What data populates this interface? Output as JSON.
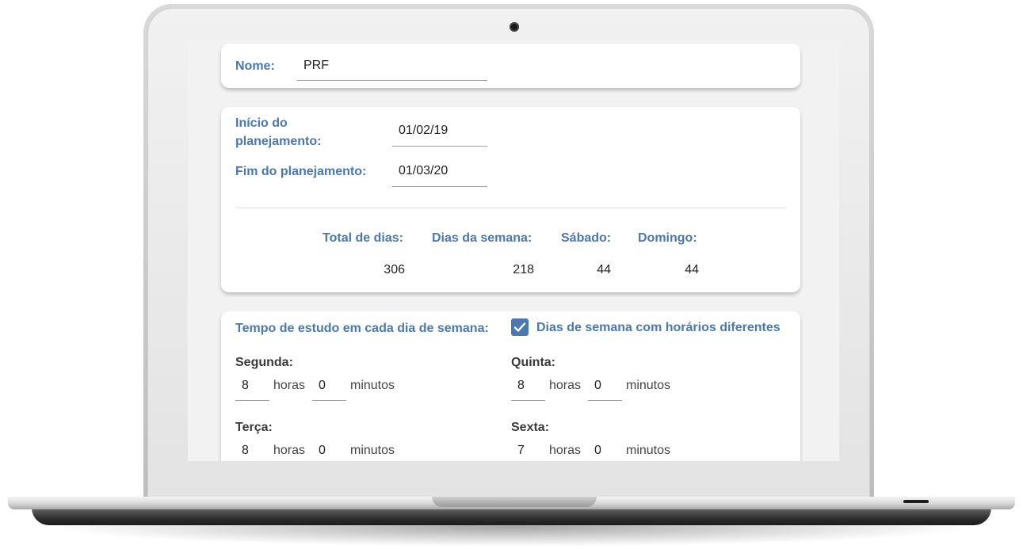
{
  "nome": {
    "label": "Nome:",
    "value": "PRF"
  },
  "planejamento": {
    "inicio_label": "Início do planejamento:",
    "inicio_value": "01/02/19",
    "fim_label": "Fim do planejamento:",
    "fim_value": "01/03/20"
  },
  "stats": [
    {
      "label": "Total de dias:",
      "value": "306"
    },
    {
      "label": "Dias da semana:",
      "value": "218"
    },
    {
      "label": "Sábado:",
      "value": "44"
    },
    {
      "label": "Domingo:",
      "value": "44"
    }
  ],
  "tempo": {
    "title": "Tempo de estudo em cada dia de semana:",
    "checkbox_label": "Dias de semana com horários diferentes",
    "checkbox_checked": true,
    "horas_unit": "horas",
    "minutos_unit": "minutos",
    "days": [
      {
        "name": "Segunda:",
        "horas": "8",
        "minutos": "0"
      },
      {
        "name": "Quinta:",
        "horas": "8",
        "minutos": "0"
      },
      {
        "name": "Terça:",
        "horas": "8",
        "minutos": "0"
      },
      {
        "name": "Sexta:",
        "horas": "7",
        "minutos": "0"
      }
    ]
  },
  "icons": {
    "checkbox": "check-icon",
    "camera": "webcam-icon"
  }
}
